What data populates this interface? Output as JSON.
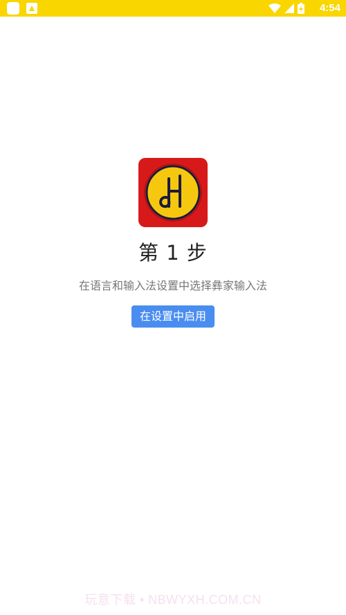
{
  "status_bar": {
    "time": "4:54",
    "background": "#f9d600",
    "icons": [
      "notification-square-icon",
      "gallery-notification-icon",
      "wifi-icon",
      "cell-signal-icon",
      "battery-charging-icon"
    ]
  },
  "app_logo": {
    "icon": "yi-keyboard-logo-icon",
    "background": "#d8191a",
    "circle_color": "#f5c80f"
  },
  "step": {
    "title": "第 1 步",
    "description": "在语言和输入法设置中选择彝家输入法",
    "button_label": "在设置中启用",
    "button_color": "#4a8df0"
  },
  "watermark": {
    "text": "玩意下载 • NBWYXH.COM.CN"
  }
}
